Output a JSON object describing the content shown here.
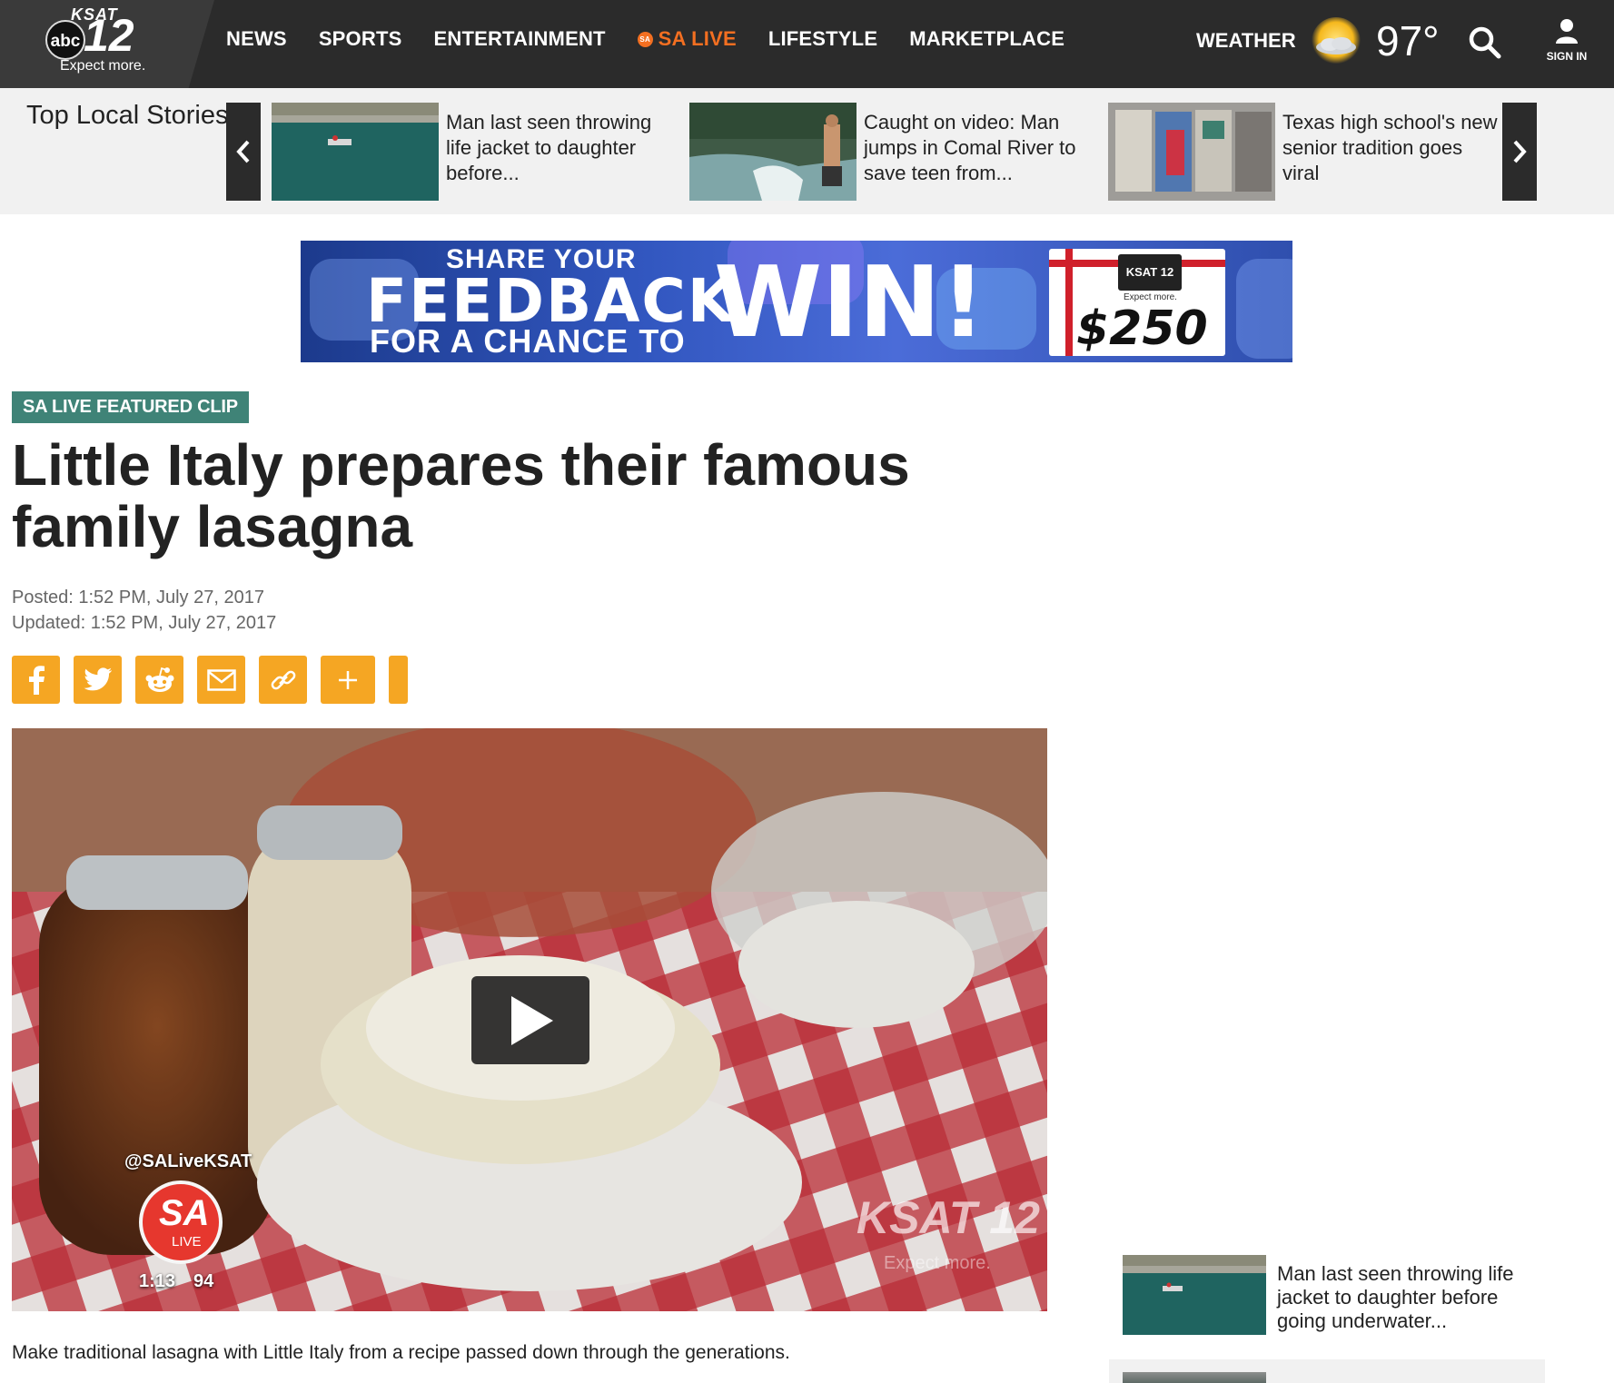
{
  "header": {
    "logo": {
      "network": "abc",
      "station": "KSAT",
      "channel": "12",
      "tagline": "Expect more."
    },
    "nav": [
      "NEWS",
      "SPORTS",
      "ENTERTAINMENT",
      "SA LIVE",
      "LIFESTYLE",
      "MARKETPLACE"
    ],
    "sa_live_badge": "SA",
    "weather_label": "WEATHER",
    "temperature": "97°",
    "weather_icon": "partly-sunny-icon",
    "search_icon": "search-icon",
    "signin_label": "SIGN IN",
    "accent_color": "#f36f21"
  },
  "top_local_stories": {
    "title": "Top Local Stories",
    "stories": [
      {
        "headline": "Man last seen throwing life jacket to daughter before..."
      },
      {
        "headline": "Caught on video: Man jumps in Comal River to save teen from..."
      },
      {
        "headline": "Texas high school's new senior tradition goes viral"
      }
    ]
  },
  "ad": {
    "line1": "SHARE YOUR",
    "line2": "FEEDBACK",
    "line3": "FOR A CHANCE TO",
    "line4": "WIN!",
    "card_station": "KSAT 12",
    "card_tagline": "Expect more.",
    "amount": "$250"
  },
  "article": {
    "badge": "SA LIVE FEATURED CLIP",
    "badge_color": "#3f8377",
    "headline": "Little Italy prepares their famous family lasagna",
    "posted": "Posted: 1:52 PM, July 27, 2017",
    "updated": "Updated: 1:52 PM, July 27, 2017",
    "share_buttons": [
      "facebook-icon",
      "twitter-icon",
      "reddit-icon",
      "email-icon",
      "link-icon",
      "plus-icon"
    ],
    "share_color": "#f5a623",
    "video": {
      "handle": "@SALiveKSAT",
      "show_logo": "SA",
      "show_logo_sub": "LIVE",
      "time": "1:13",
      "temp_overlay": "94",
      "watermark": "KSAT 12",
      "watermark_tag": "Expect more."
    },
    "caption": "Make traditional lasagna with Little Italy from a recipe passed down through the generations."
  },
  "sidebar": {
    "story": {
      "headline": "Man last seen throwing life jacket to daughter before going underwater..."
    }
  }
}
